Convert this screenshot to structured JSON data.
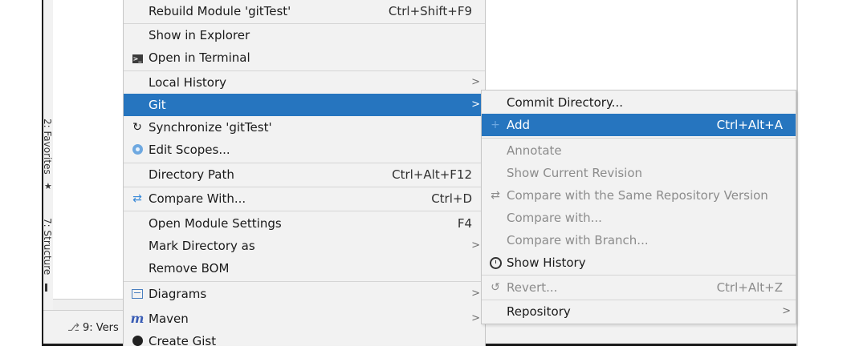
{
  "tool_windows": {
    "favorites": "2: Favorites",
    "structure": "7: Structure",
    "version_control_tab": "9: Vers"
  },
  "context_menu": {
    "items": [
      {
        "label": "Rebuild Module 'gitTest'",
        "shortcut": "Ctrl+Shift+F9"
      },
      {
        "label": "Show in Explorer"
      },
      {
        "label": "Open in Terminal",
        "icon": "terminal-icon"
      },
      {
        "label": "Local History",
        "submenu": true
      },
      {
        "label": "Git",
        "submenu": true,
        "selected": true
      },
      {
        "label": "Synchronize 'gitTest'",
        "icon": "sync-icon"
      },
      {
        "label": "Edit Scopes...",
        "icon": "scope-icon"
      },
      {
        "label": "Directory Path",
        "shortcut": "Ctrl+Alt+F12"
      },
      {
        "label": "Compare With...",
        "shortcut": "Ctrl+D",
        "icon": "compare-icon"
      },
      {
        "label": "Open Module Settings",
        "shortcut": "F4"
      },
      {
        "label": "Mark Directory as",
        "submenu": true
      },
      {
        "label": "Remove BOM"
      },
      {
        "label": "Diagrams",
        "submenu": true,
        "icon": "diagram-icon"
      },
      {
        "label": "Maven",
        "submenu": true,
        "icon": "maven-icon"
      },
      {
        "label": "Create Gist",
        "icon": "github-icon"
      }
    ]
  },
  "git_submenu": {
    "items": [
      {
        "label": "Commit Directory..."
      },
      {
        "label": "Add",
        "shortcut": "Ctrl+Alt+A",
        "selected": true,
        "icon": "plus-icon"
      },
      {
        "label": "Annotate",
        "disabled": true
      },
      {
        "label": "Show Current Revision",
        "disabled": true
      },
      {
        "label": "Compare with the Same Repository Version",
        "disabled": true,
        "icon": "compare-icon"
      },
      {
        "label": "Compare with...",
        "disabled": true
      },
      {
        "label": "Compare with Branch...",
        "disabled": true
      },
      {
        "label": "Show History",
        "icon": "clock-icon"
      },
      {
        "label": "Revert...",
        "shortcut": "Ctrl+Alt+Z",
        "disabled": true,
        "icon": "revert-icon"
      },
      {
        "label": "Repository",
        "submenu": true
      }
    ]
  },
  "colors": {
    "selection": "#2675bf",
    "menu_bg": "#f2f2f2",
    "disabled_text": "#8c8c8c"
  }
}
